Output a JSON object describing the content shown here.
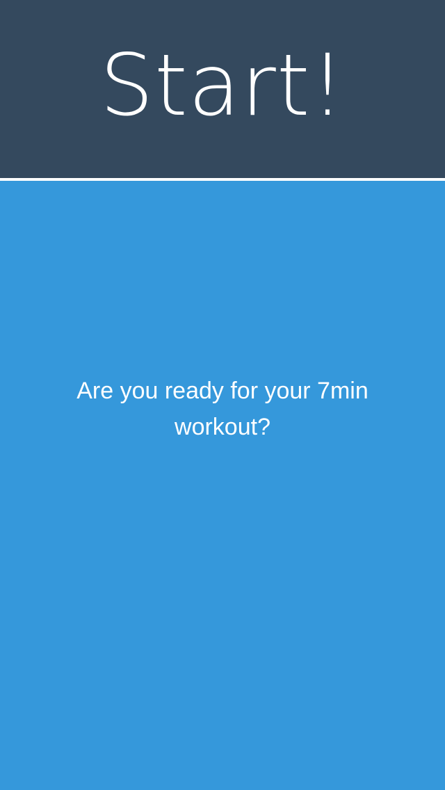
{
  "header": {
    "title": "Start!",
    "background_color": "#34495e"
  },
  "main": {
    "prompt": "Are you ready for your 7min workout?",
    "background_color": "#3598db"
  }
}
